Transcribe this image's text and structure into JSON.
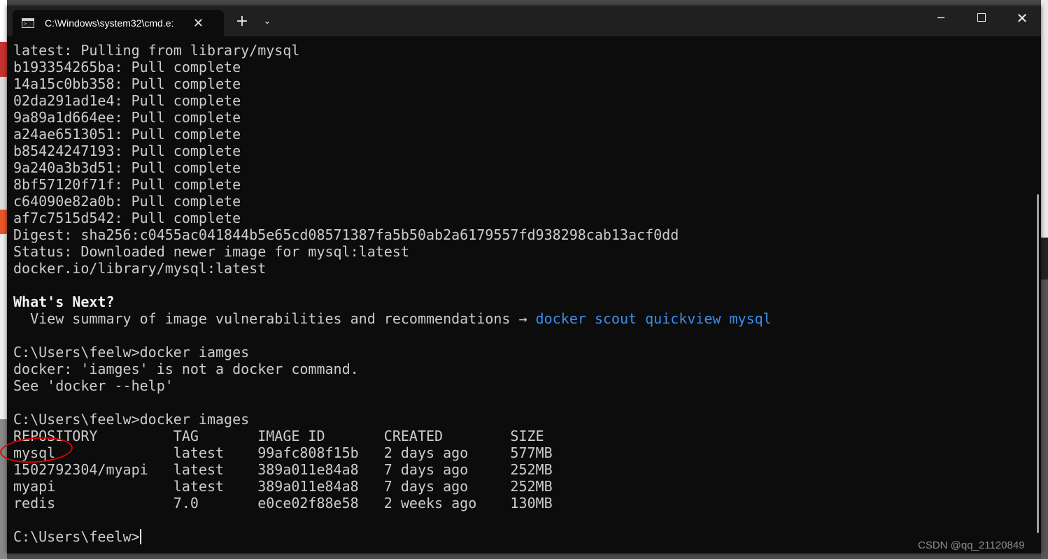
{
  "window": {
    "tab_title": "C:\\Windows\\system32\\cmd.e:",
    "tab_icon_glyph": ">_",
    "close_tab_glyph": "✕",
    "new_tab_glyph": "+",
    "dropdown_glyph": "⌄",
    "minimize_glyph": "─",
    "close_glyph": "✕"
  },
  "terminal": {
    "lines": [
      {
        "text": "latest: Pulling from library/mysql"
      },
      {
        "text": "b193354265ba: Pull complete"
      },
      {
        "text": "14a15c0bb358: Pull complete"
      },
      {
        "text": "02da291ad1e4: Pull complete"
      },
      {
        "text": "9a89a1d664ee: Pull complete"
      },
      {
        "text": "a24ae6513051: Pull complete"
      },
      {
        "text": "b85424247193: Pull complete"
      },
      {
        "text": "9a240a3b3d51: Pull complete"
      },
      {
        "text": "8bf57120f71f: Pull complete"
      },
      {
        "text": "c64090e82a0b: Pull complete"
      },
      {
        "text": "af7c7515d542: Pull complete"
      },
      {
        "text": "Digest: sha256:c0455ac041844b5e65cd08571387fa5b50ab2a6179557fd938298cab13acf0dd"
      },
      {
        "text": "Status: Downloaded newer image for mysql:latest"
      },
      {
        "text": "docker.io/library/mysql:latest"
      },
      {
        "text": ""
      },
      {
        "text": "What's Next?",
        "style": "bold"
      },
      {
        "text": "  View summary of image vulnerabilities and recommendations → ",
        "link": "docker scout quickview mysql"
      },
      {
        "text": ""
      },
      {
        "text": "C:\\Users\\feelw>docker iamges"
      },
      {
        "text": "docker: 'iamges' is not a docker command."
      },
      {
        "text": "See 'docker --help'"
      },
      {
        "text": ""
      },
      {
        "text": "C:\\Users\\feelw>docker images"
      },
      {
        "text": "REPOSITORY         TAG       IMAGE ID       CREATED        SIZE"
      },
      {
        "text": "mysql              latest    99afc808f15b   2 days ago     577MB"
      },
      {
        "text": "1502792304/myapi   latest    389a011e84a8   7 days ago     252MB"
      },
      {
        "text": "myapi              latest    389a011e84a8   7 days ago     252MB"
      },
      {
        "text": "redis              7.0       e0ce02f88e58   2 weeks ago    130MB"
      },
      {
        "text": ""
      },
      {
        "text": "C:\\Users\\feelw>",
        "cursor": true
      }
    ]
  },
  "watermark": "CSDN @qq_21120849",
  "colors": {
    "terminal_bg": "#0c0c0c",
    "terminal_fg": "#cccccc",
    "link": "#3b8eea",
    "titlebar_bg": "#202020",
    "annotation": "#e00000"
  }
}
